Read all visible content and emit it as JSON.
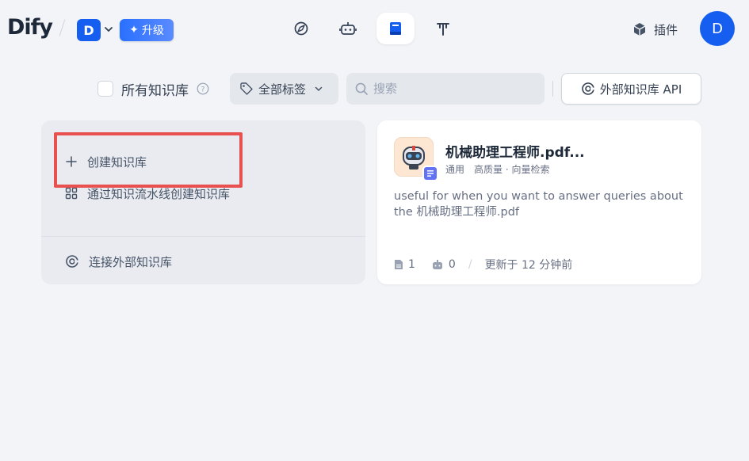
{
  "header": {
    "logo": "Dify",
    "workspace_initial": "D",
    "upgrade_label": "升级",
    "nav": [
      "explore-icon",
      "studio-robot-icon",
      "knowledge-book-icon",
      "tools-icon"
    ],
    "plugins_label": "插件",
    "user_initial": "D"
  },
  "filters": {
    "all_kb_label": "所有知识库",
    "tags_label": "全部标签",
    "search_placeholder": "搜索",
    "external_api_label": "外部知识库 API"
  },
  "create_card": {
    "create_label": "创建知识库",
    "pipeline_label": "通过知识流水线创建知识库",
    "connect_external_label": "连接外部知识库"
  },
  "dataset": {
    "title": "机械助理工程师.pdf...",
    "tag_type": "通用",
    "tag_index": "高质量 · 向量检索",
    "description": "useful for when you want to answer queries about the 机械助理工程师.pdf",
    "doc_count": "1",
    "app_count": "0",
    "updated": "更新于 12 分钟前"
  },
  "colors": {
    "accent": "#155eef",
    "highlight": "#e8514f",
    "background": "#f2f4f7"
  }
}
